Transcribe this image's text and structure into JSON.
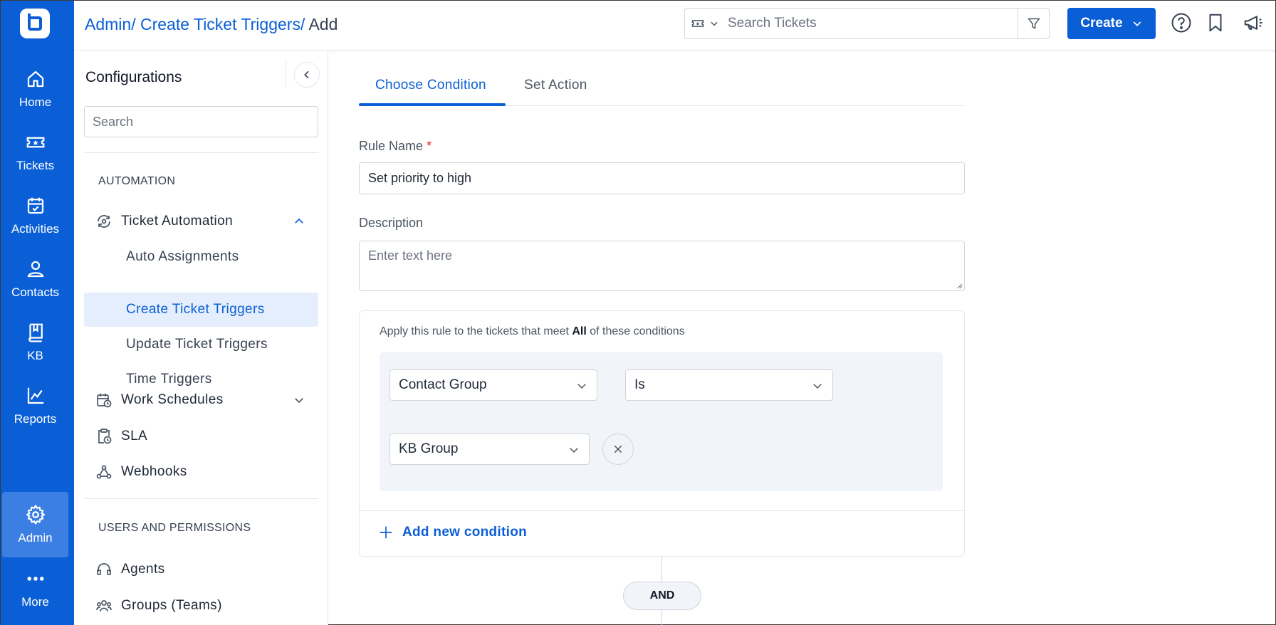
{
  "rail": {
    "items": [
      {
        "label": "Home",
        "icon": "home-icon"
      },
      {
        "label": "Tickets",
        "icon": "ticket-icon"
      },
      {
        "label": "Activities",
        "icon": "calendar-check-icon"
      },
      {
        "label": "Contacts",
        "icon": "person-icon"
      },
      {
        "label": "KB",
        "icon": "book-icon"
      },
      {
        "label": "Reports",
        "icon": "chart-line-icon"
      },
      {
        "label": "Admin",
        "icon": "gear-icon",
        "active": true
      },
      {
        "label": "More",
        "icon": "more-dots-icon"
      }
    ],
    "color": "#0a5fd6"
  },
  "header": {
    "breadcrumb": {
      "admin": "Admin/",
      "triggers": "Create Ticket Triggers/",
      "current": "Add"
    },
    "search_placeholder": "Search Tickets",
    "create_label": "Create"
  },
  "config": {
    "title": "Configurations",
    "search_placeholder": "Search",
    "sections": {
      "automation": "AUTOMATION",
      "users": "USERS AND PERMISSIONS"
    },
    "ticket_automation": "Ticket Automation",
    "children": [
      "Auto Assignments",
      "Create Ticket Triggers",
      "Update Ticket Triggers",
      "Time Triggers"
    ],
    "active_child": "Create Ticket Triggers",
    "work_schedules": "Work Schedules",
    "sla": "SLA",
    "webhooks": "Webhooks",
    "agents": "Agents",
    "groups": "Groups (Teams)"
  },
  "main": {
    "tabs": [
      "Choose Condition",
      "Set Action"
    ],
    "active_tab": "Choose Condition",
    "rule_name_label": "Rule Name",
    "required_mark": "*",
    "rule_name_value": "Set priority to high",
    "description_label": "Description",
    "description_placeholder": "Enter text here",
    "conditions": {
      "intro_prefix": "Apply this rule to the tickets that meet",
      "intro_match": "All",
      "intro_suffix": "of these conditions",
      "field": "Contact Group",
      "operator": "Is",
      "value": "KB Group",
      "add_label": "Add new condition"
    },
    "and_label": "AND"
  }
}
